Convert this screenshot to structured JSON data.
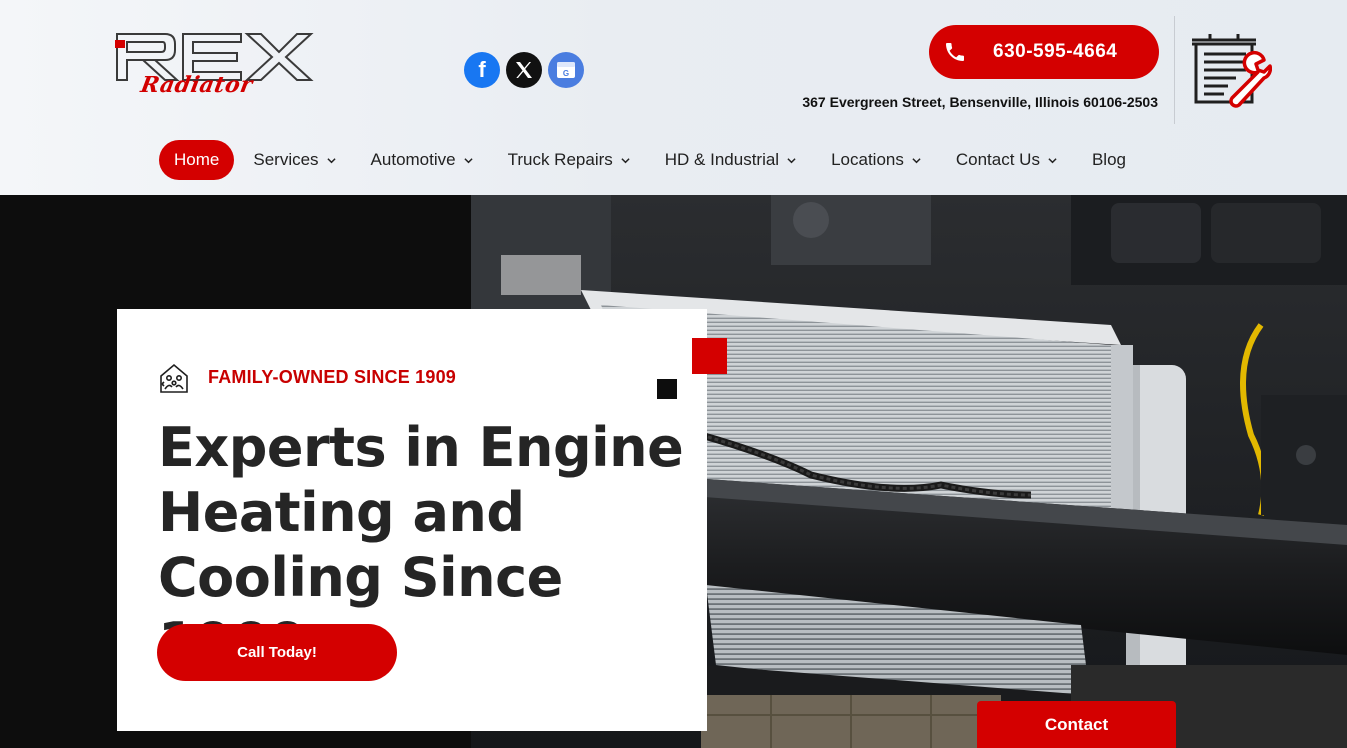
{
  "brand": {
    "logo_text": "REX",
    "logo_script": "Radiator"
  },
  "socials": [
    {
      "name": "facebook",
      "glyph": "f"
    },
    {
      "name": "x",
      "glyph": "𝕏"
    },
    {
      "name": "google-business",
      "glyph": "G"
    }
  ],
  "header": {
    "phone": "630-595-4664",
    "address": "367 Evergreen Street, Bensenville, Illinois 60106-2503"
  },
  "nav": {
    "items": [
      {
        "label": "Home",
        "active": true,
        "dropdown": false
      },
      {
        "label": "Services",
        "dropdown": true
      },
      {
        "label": "Automotive",
        "dropdown": true
      },
      {
        "label": "Truck Repairs",
        "dropdown": true
      },
      {
        "label": "HD & Industrial",
        "dropdown": true
      },
      {
        "label": "Locations",
        "dropdown": true
      },
      {
        "label": "Contact Us",
        "dropdown": true
      },
      {
        "label": "Blog",
        "dropdown": false
      }
    ]
  },
  "hero": {
    "tagline": "FAMILY-OWNED SINCE 1909",
    "headline": "Experts in Engine Heating and Cooling Since 1909",
    "cta_label": "Call Today!"
  },
  "contact_tab": {
    "label": "Contact"
  },
  "colors": {
    "accent": "#d40000",
    "text_dark": "#252525",
    "hero_bg": "#0d0d0d"
  }
}
